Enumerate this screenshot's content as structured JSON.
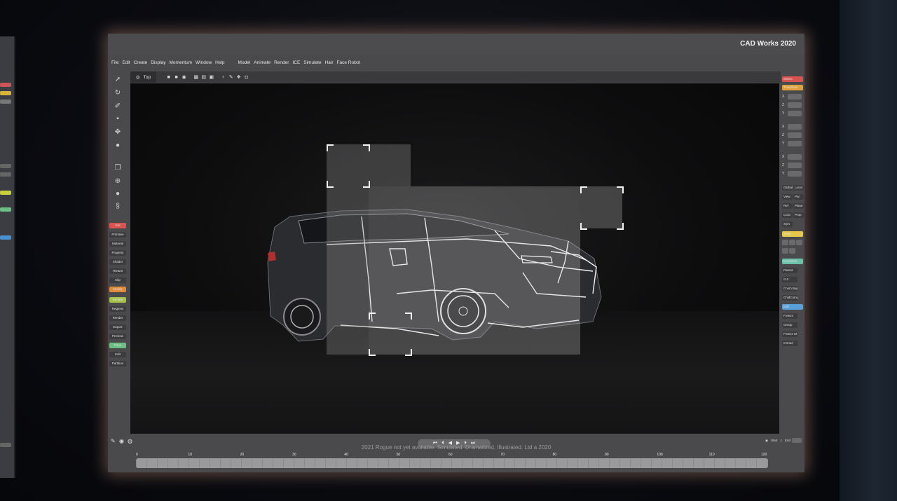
{
  "app": {
    "title": "CAD Works 2020"
  },
  "menu": {
    "primary": [
      "File",
      "Edit",
      "Create",
      "Display",
      "Momentum",
      "Window",
      "Help"
    ],
    "secondary": [
      "Model",
      "Animate",
      "Render",
      "ICE",
      "Simulate",
      "Hair",
      "Face Robot"
    ]
  },
  "viewport": {
    "label": "Top"
  },
  "left_tools": {
    "buttons": [
      {
        "label": "Get",
        "color": "#d9534f"
      },
      {
        "label": "Primitive",
        "color": "#3c3c3e"
      },
      {
        "label": "Material",
        "color": "#3c3c3e"
      },
      {
        "label": "Property",
        "color": "#3c3c3e"
      },
      {
        "label": "Shader",
        "color": "#3c3c3e"
      },
      {
        "label": "Texture",
        "color": "#3c3c3e"
      },
      {
        "label": "Clip",
        "color": "#3c3c3e"
      },
      {
        "label": "Modify",
        "color": "#e08a3c"
      },
      {
        "label": "Render",
        "color": "#a6c24a"
      },
      {
        "label": "Regions",
        "color": "#3c3c3e"
      },
      {
        "label": "Render",
        "color": "#3c3c3e"
      },
      {
        "label": "Export",
        "color": "#3c3c3e"
      },
      {
        "label": "Preview",
        "color": "#3c3c3e"
      },
      {
        "label": "Pass",
        "color": "#6cbf84"
      },
      {
        "label": "Edit",
        "color": "#3c3c3e"
      },
      {
        "label": "Partition",
        "color": "#3c3c3e"
      }
    ]
  },
  "right_tools": {
    "select": {
      "label": "Select",
      "color": "#d9534f"
    },
    "transform": {
      "label": "Transform",
      "color": "#e0a03c"
    },
    "axes": [
      "X",
      "Z",
      "Y",
      "X",
      "Z",
      "Y",
      "X",
      "Z",
      "Y"
    ],
    "pairs": [
      [
        "Global",
        "Local"
      ],
      [
        "View",
        "Par"
      ],
      [
        "Ref",
        "Plane"
      ],
      [
        "COG",
        "Prop"
      ]
    ],
    "sym": "Sym",
    "snap": {
      "label": "Snap",
      "color": "#e8c84a"
    },
    "constrain": {
      "label": "Constrain",
      "color": "#6cc2a8"
    },
    "constrain_items": [
      "Parent",
      "Cut",
      "CnsComp",
      "ChldComp"
    ],
    "edit": {
      "label": "Edit",
      "color": "#5aa0d8"
    },
    "edit_items": [
      "Freeze",
      "Group",
      "Freeze M",
      "Immed"
    ]
  },
  "timeline": {
    "ticks": [
      "0",
      "10",
      "20",
      "30",
      "40",
      "50",
      "60",
      "70",
      "80",
      "90",
      "100",
      "110",
      "120"
    ],
    "start_label": "Start",
    "start_value": "1",
    "end_label": "End"
  },
  "caption": "2021 Rogue not yet available. Simulated. Dramatized. Illustrated. Ltd a 2020"
}
